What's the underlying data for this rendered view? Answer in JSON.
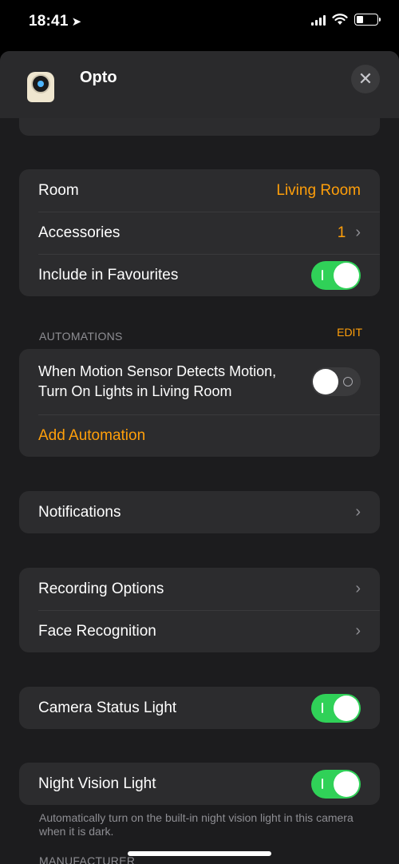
{
  "status": {
    "time": "18:41"
  },
  "header": {
    "title": "Opto",
    "close_glyph": "✕"
  },
  "room_group": {
    "room_label": "Room",
    "room_value": "Living Room",
    "accessories_label": "Accessories",
    "accessories_value": "1",
    "favourites_label": "Include in Favourites",
    "favourites_on": true
  },
  "automations": {
    "header": "AUTOMATIONS",
    "edit_label": "EDIT",
    "rule_line1": "When Motion Sensor Detects Motion,",
    "rule_line2": "Turn On Lights in Living Room",
    "rule_on": false,
    "add_label": "Add Automation"
  },
  "notifications": {
    "label": "Notifications"
  },
  "recording": {
    "options_label": "Recording Options",
    "face_label": "Face Recognition"
  },
  "camera_status": {
    "label": "Camera Status Light",
    "on": true
  },
  "night_vision": {
    "label": "Night Vision Light",
    "on": true,
    "footnote": "Automatically turn on the built-in night vision light in this camera when it is dark."
  },
  "manufacturer": {
    "header": "MANUFACTURER"
  },
  "colors": {
    "accent": "#ff9f0a",
    "toggle_on": "#30d158",
    "background": "#1c1c1e",
    "cell": "#2c2c2e"
  },
  "icons": [
    "location-arrow-icon",
    "signal-icon",
    "wifi-icon",
    "battery-icon",
    "camera-device-icon",
    "close-icon",
    "chevron-right-icon"
  ]
}
